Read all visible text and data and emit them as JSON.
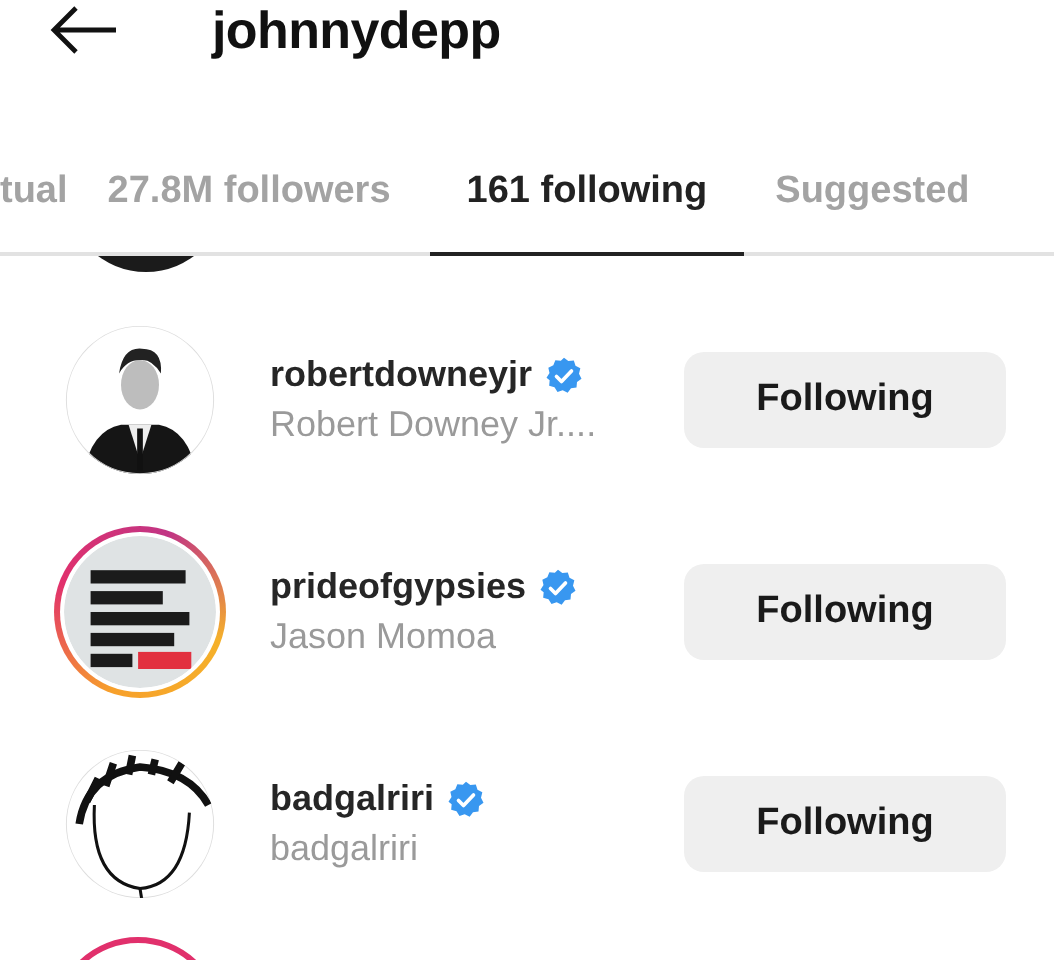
{
  "header": {
    "title": "johnnydepp"
  },
  "tabs": [
    {
      "label": "tual",
      "selected": false
    },
    {
      "label": "27.8M followers",
      "selected": false
    },
    {
      "label": "161 following",
      "selected": true
    },
    {
      "label": "Suggested",
      "selected": false
    }
  ],
  "top_partial_avatar": {
    "story": false
  },
  "rows": [
    {
      "username": "robertdowneyjr",
      "verified": true,
      "name": "Robert Downey Jr....",
      "story": false,
      "button": "Following"
    },
    {
      "username": "prideofgypsies",
      "verified": true,
      "name": "Jason Momoa",
      "story": true,
      "button": "Following"
    },
    {
      "username": "badgalriri",
      "verified": true,
      "name": "badgalriri",
      "story": false,
      "button": "Following"
    }
  ],
  "bottom_partial_avatar": {
    "story": true
  }
}
